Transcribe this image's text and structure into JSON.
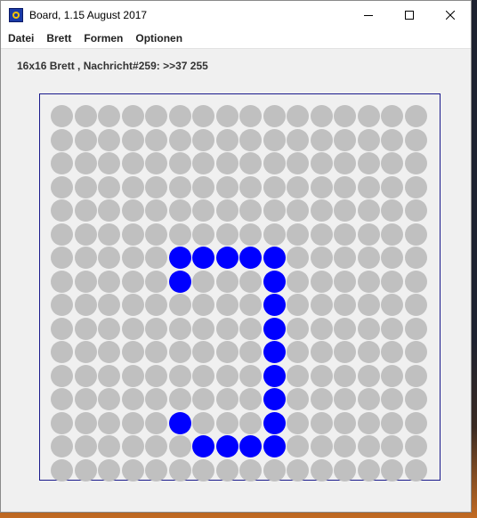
{
  "window": {
    "title": "Board, 1.15 August 2017",
    "controls": {
      "minimize": "–",
      "maximize": "☐",
      "close": "✕"
    },
    "icon": "board-app-icon"
  },
  "menu": {
    "items": [
      "Datei",
      "Brett",
      "Formen",
      "Optionen"
    ]
  },
  "status": {
    "message": "16x16 Brett , Nachricht#259: >>37 255"
  },
  "board": {
    "rows": 16,
    "cols": 16,
    "off_color": "#c0c0c0",
    "on_color": "#0000ff",
    "on_cells": [
      [
        6,
        5
      ],
      [
        6,
        6
      ],
      [
        6,
        7
      ],
      [
        6,
        8
      ],
      [
        6,
        9
      ],
      [
        7,
        5
      ],
      [
        7,
        9
      ],
      [
        8,
        9
      ],
      [
        9,
        9
      ],
      [
        10,
        9
      ],
      [
        11,
        9
      ],
      [
        12,
        9
      ],
      [
        13,
        5
      ],
      [
        13,
        9
      ],
      [
        14,
        6
      ],
      [
        14,
        7
      ],
      [
        14,
        8
      ],
      [
        14,
        9
      ]
    ]
  }
}
